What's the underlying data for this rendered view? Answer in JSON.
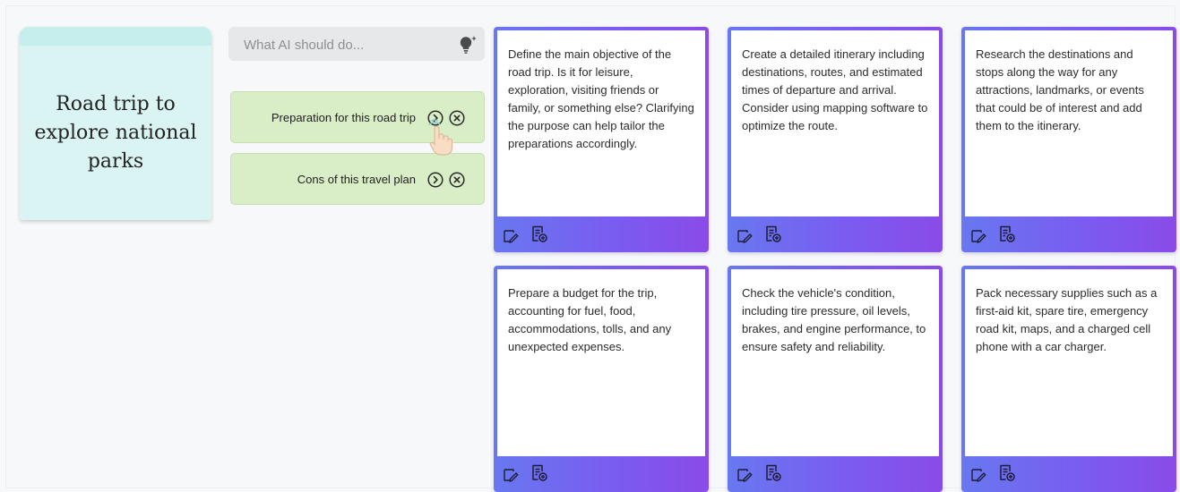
{
  "topic": {
    "text": "Road trip to explore national parks",
    "color": "#daf4f4"
  },
  "prompt": {
    "placeholder": "What AI should do...",
    "value": "",
    "icon": "lightbulb-sparkle-icon"
  },
  "options": [
    {
      "label": "Preparation for this road trip",
      "go_icon": "chevron-right-circle-icon",
      "close_icon": "close-circle-icon"
    },
    {
      "label": "Cons of this travel plan",
      "go_icon": "chevron-right-circle-icon",
      "close_icon": "close-circle-icon"
    }
  ],
  "cursor_icon": "hand-pointer-icon",
  "cards": [
    {
      "text": "Define the main objective of the road trip. Is it for leisure, exploration, visiting friends or family, or something else? Clarifying the purpose can help tailor the preparations accordingly.",
      "edit_icon": "edit-note-icon",
      "expand_icon": "add-document-icon"
    },
    {
      "text": "Create a detailed itinerary including destinations, routes, and estimated times of departure and arrival. Consider using mapping software to optimize the route.",
      "edit_icon": "edit-note-icon",
      "expand_icon": "add-document-icon"
    },
    {
      "text": "Research the destinations and stops along the way for any attractions, landmarks, or events that could be of interest and add them to the itinerary.",
      "edit_icon": "edit-note-icon",
      "expand_icon": "add-document-icon"
    },
    {
      "text": "Prepare a budget for the trip, accounting for fuel, food, accommodations, tolls, and any unexpected expenses.",
      "edit_icon": "edit-note-icon",
      "expand_icon": "add-document-icon"
    },
    {
      "text": "Check the vehicle's condition, including tire pressure, oil levels, brakes, and engine performance, to ensure safety and reliability.",
      "edit_icon": "edit-note-icon",
      "expand_icon": "add-document-icon"
    },
    {
      "text": "Pack necessary supplies such as a first-aid kit, spare tire, emergency road kit, maps, and a charged cell phone with a car charger.",
      "edit_icon": "edit-note-icon",
      "expand_icon": "add-document-icon"
    }
  ],
  "colors": {
    "card_gradient_start": "#6878f0",
    "card_gradient_end": "#8a4be8",
    "option_bg": "#d9eec6",
    "page_bg": "#f7f8fa"
  }
}
